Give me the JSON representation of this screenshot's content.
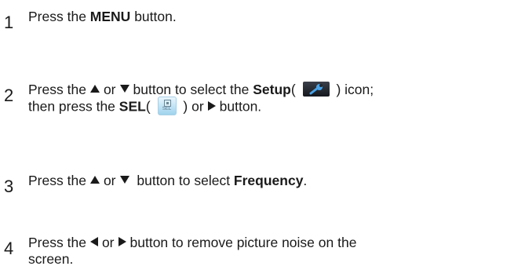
{
  "steps": [
    {
      "number": "1",
      "parts": {
        "a": "Press the ",
        "b": "MENU",
        "c": " button."
      }
    },
    {
      "number": "2",
      "parts": {
        "a": "Press the",
        "b": "or",
        "c": "button to select the ",
        "d": "Setup",
        "e": "( ",
        "f": " ) icon;",
        "g": "then press the ",
        "h": "SEL",
        "i": "( ",
        "j": " ) or",
        "k": "button."
      },
      "sel_icon_label": "SEL"
    },
    {
      "number": "3",
      "parts": {
        "a": "Press the",
        "b": "or",
        "c": " button to select ",
        "d": "Frequency",
        "e": "."
      }
    },
    {
      "number": "4",
      "parts": {
        "a": "Press the",
        "b": "or",
        "c": "button to remove picture noise on the",
        "d": "screen."
      }
    }
  ],
  "icons": {
    "up": "up-triangle",
    "down": "down-triangle",
    "left": "left-triangle",
    "right": "right-triangle",
    "setup": "wrench-icon",
    "sel": "sel-button-icon"
  },
  "colors": {
    "text": "#1a1a1a",
    "setup_icon_bg": "#23272e",
    "setup_wrench": "#4aa3e8",
    "sel_icon_bg": "#bfe3f5"
  }
}
